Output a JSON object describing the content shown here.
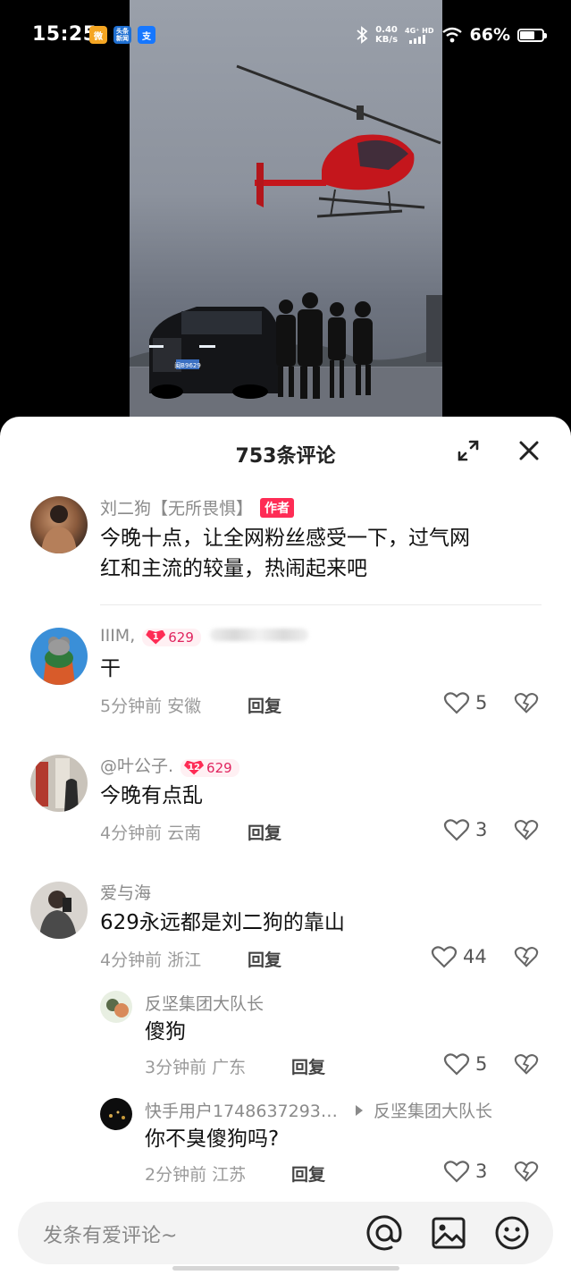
{
  "status_bar": {
    "time": "15:25",
    "badges": {
      "weibo": "微",
      "news": "头条新闻",
      "alipay": "支"
    },
    "net_speed": "0.40",
    "net_unit": "KB/s",
    "net_type": "4G⁺ HD",
    "battery": "66%",
    "battery_level": 0.66
  },
  "video": {
    "plate": "闽B9629"
  },
  "sheet": {
    "title": "753条评论"
  },
  "comments": [
    {
      "name": "刘二狗【无所畏惧】",
      "tag": "作者",
      "text_line1": "今晚十点，让全网粉丝感受一下，过气网",
      "text_line2": "红和主流的较量，热闹起来吧"
    },
    {
      "name": "IIIM,",
      "fan_level": "1",
      "fan_label": "629",
      "text": "干",
      "time": "5分钟前",
      "location": "安徽",
      "reply": "回复",
      "likes": "5"
    },
    {
      "name": "@叶公子.",
      "fan_level": "12",
      "fan_label": "629",
      "text": "今晚有点乱",
      "time": "4分钟前",
      "location": "云南",
      "reply": "回复",
      "likes": "3"
    },
    {
      "name": "爱与海",
      "text": "629永远都是刘二狗的靠山",
      "time": "4分钟前",
      "location": "浙江",
      "reply": "回复",
      "likes": "44"
    }
  ],
  "replies": [
    {
      "name": "反坚集团大队长",
      "text": "傻狗",
      "time": "3分钟前",
      "location": "广东",
      "reply": "回复",
      "likes": "5"
    },
    {
      "name": "快手用户1748637293…",
      "reply_to": "反坚集团大队长",
      "text": "你不臭傻狗吗?",
      "time": "2分钟前",
      "location": "江苏",
      "reply": "回复",
      "likes": "3"
    }
  ],
  "input": {
    "placeholder": "发条有爱评论~"
  }
}
